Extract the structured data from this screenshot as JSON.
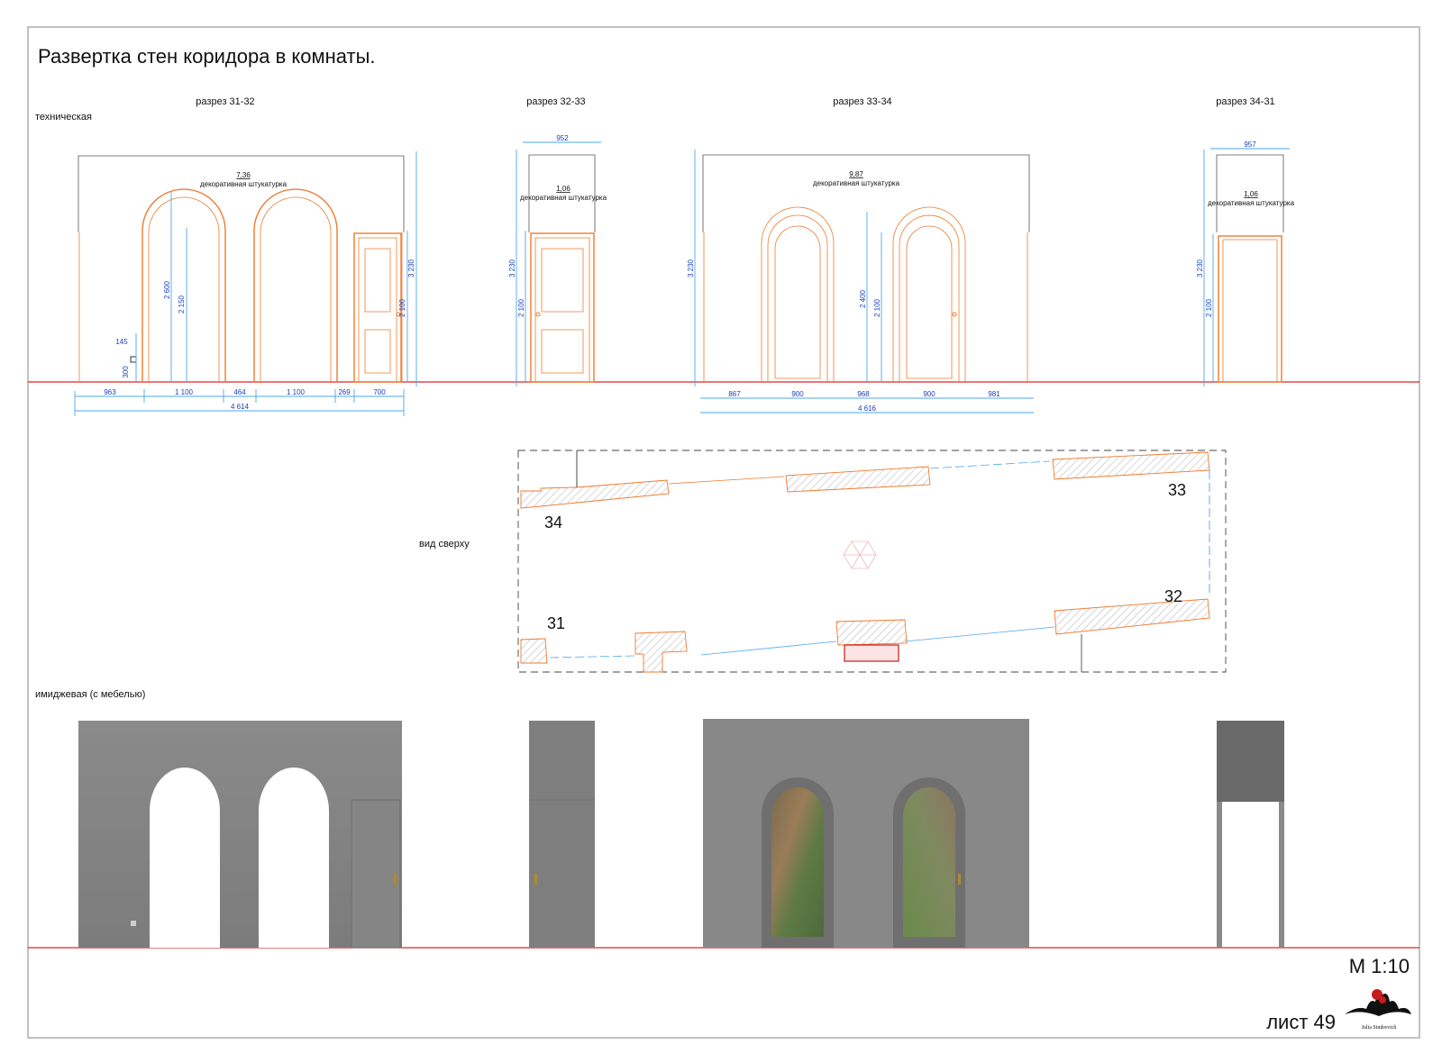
{
  "title": "Развертка стен коридора в комнаты.",
  "labels": {
    "technical": "техническая",
    "top_view": "вид сверху",
    "image_with_furniture": "имиджевая (с мебелью)"
  },
  "sections": [
    {
      "name": "разрез 31-32",
      "area": "7,36",
      "finish": "декоративная штукатурка"
    },
    {
      "name": "разрез 32-33",
      "area": "1,06",
      "finish": "декоративная штукатурка"
    },
    {
      "name": "разрез 33-34",
      "area": "9,87",
      "finish": "декоративная штукатурка"
    },
    {
      "name": "разрез 34-31",
      "area": "1,06",
      "finish": "декоративная штукатурка"
    }
  ],
  "dimensions": {
    "s1": {
      "height_total": "3 230",
      "door_h": "2 100",
      "arch_h1": "2 600",
      "arch_h2": "2 150",
      "socket_offset": "145",
      "socket_h": "300",
      "run": [
        "963",
        "1 100",
        "464",
        "1 100",
        "269",
        "700"
      ],
      "total": "4 614"
    },
    "s2": {
      "width": "952",
      "height_total": "3 230",
      "door_h": "2 100"
    },
    "s3": {
      "height_total": "3 230",
      "arch_h": "2 400",
      "door_h": "2 100",
      "run": [
        "867",
        "900",
        "968",
        "900",
        "981"
      ],
      "total": "4 616"
    },
    "s4": {
      "width": "957",
      "height_total": "3 230",
      "door_h": "2 100"
    }
  },
  "plan_marks": [
    "34",
    "33",
    "32",
    "31"
  ],
  "scale": "М 1:10",
  "sheet": "лист 49",
  "logo_text": "Julia Sindrevich",
  "colors": {
    "dimension_line": "#4ea6f0",
    "dimension_text": "#1a3fbf",
    "outline_orange": "#ee7a2e",
    "floor_line": "#e02424",
    "wall_render": "#8e8e8e"
  }
}
